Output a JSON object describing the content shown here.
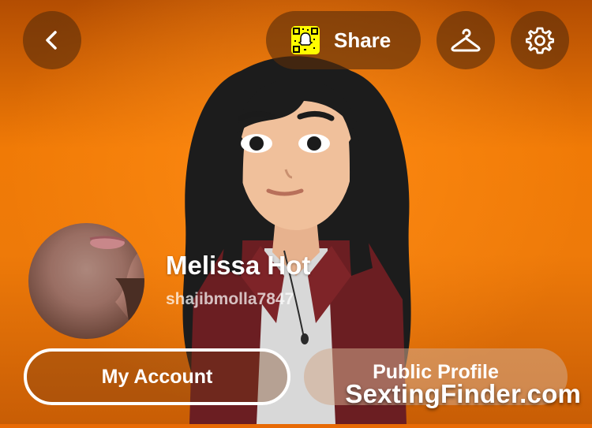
{
  "header": {
    "back_icon": "chevron-left-icon",
    "share_label": "Share",
    "snapcode_icon": "snapcode-icon",
    "outfit_icon": "hanger-icon",
    "settings_icon": "gear-icon"
  },
  "profile": {
    "display_name": "Melissa Hot",
    "username": "shajibmolla7847"
  },
  "actions": {
    "my_account_label": "My Account",
    "public_profile_label": "Public Profile"
  },
  "watermark": "SextingFinder.com",
  "colors": {
    "background": "#ee7a09",
    "button_overlay": "#5a2d0a",
    "snapcode_yellow": "#fffc00",
    "text": "#ffffff"
  }
}
